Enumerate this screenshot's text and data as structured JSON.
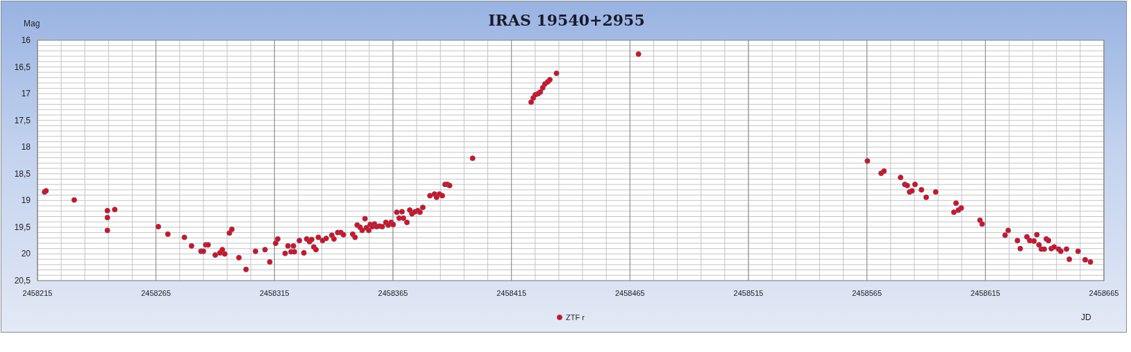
{
  "chart": {
    "chart_data": {
      "type": "scatter",
      "title": "IRAS 19540+2955",
      "xlabel": "JD",
      "ylabel": "Mag",
      "x": [
        2458218,
        2458218.6,
        2458230.5,
        2458244.5,
        2458244.5,
        2458244.5,
        2458247.6,
        2458266,
        2458270,
        2458277,
        2458280,
        2458284,
        2458285,
        2458286,
        2458287,
        2458290,
        2458292,
        2458293,
        2458294,
        2458296,
        2458297,
        2458300,
        2458303,
        2458307,
        2458311,
        2458313,
        2458315.5,
        2458316.4,
        2458319.5,
        2458320.7,
        2458322,
        2458323,
        2458323.4,
        2458325.5,
        2458327.4,
        2458328.6,
        2458329.8,
        2458330.7,
        2458331.6,
        2458332.5,
        2458333.5,
        2458335.3,
        2458336.8,
        2458339.2,
        2458340.1,
        2458341.7,
        2458343,
        2458344.1,
        2458348,
        2458349,
        2458349.9,
        2458351.1,
        2458352,
        2458353.2,
        2458353.8,
        2458354.8,
        2458355.4,
        2458356.3,
        2458357.2,
        2458358.1,
        2458359.3,
        2458360.5,
        2458362,
        2458363,
        2458364.2,
        2458365.1,
        2458366.6,
        2458367.6,
        2458368.8,
        2458369.4,
        2458370.9,
        2458372.1,
        2458373,
        2458374.3,
        2458375.5,
        2458376.4,
        2458377.6,
        2458380.6,
        2458382.5,
        2458383.4,
        2458384.6,
        2458385.8,
        2458387,
        2458388,
        2458388.9,
        2458398.6,
        2458423.3,
        2458424.2,
        2458425.1,
        2458426.3,
        2458427.2,
        2458428.2,
        2458429.1,
        2458430.3,
        2458431.2,
        2458434,
        2458468.6,
        2458565.2,
        2458571,
        2458572.2,
        2458579.2,
        2458581,
        2458582,
        2458583,
        2458584,
        2458585.3,
        2458588,
        2458590,
        2458594,
        2458601.7,
        2458602.6,
        2458603.6,
        2458604.8,
        2458612.7,
        2458613.6,
        2458623.3,
        2458624.6,
        2458628.5,
        2458629.7,
        2458632.5,
        2458633.7,
        2458635.5,
        2458636.7,
        2458637.6,
        2458638.6,
        2458639.8,
        2458640.7,
        2458641.6,
        2458642.8,
        2458644,
        2458645.9,
        2458646.8,
        2458649.2,
        2458650.4,
        2458654.1,
        2458657.1,
        2458659.3
      ],
      "series": [
        {
          "name": "ZTF r",
          "color": "#ff0000",
          "values": [
            18.84,
            18.82,
            18.99,
            19.19,
            19.32,
            19.56,
            19.17,
            19.49,
            19.63,
            19.69,
            19.85,
            19.95,
            19.95,
            19.83,
            19.83,
            20.02,
            19.98,
            19.92,
            20.0,
            19.61,
            19.54,
            20.07,
            20.29,
            19.95,
            19.92,
            20.15,
            19.8,
            19.72,
            19.99,
            19.85,
            19.96,
            19.85,
            19.96,
            19.75,
            19.98,
            19.72,
            19.77,
            19.73,
            19.87,
            19.92,
            19.69,
            19.75,
            19.71,
            19.65,
            19.72,
            19.6,
            19.6,
            19.64,
            19.63,
            19.69,
            19.46,
            19.5,
            19.56,
            19.34,
            19.51,
            19.56,
            19.45,
            19.49,
            19.44,
            19.49,
            19.48,
            19.49,
            19.41,
            19.46,
            19.41,
            19.45,
            19.22,
            19.33,
            19.21,
            19.33,
            19.41,
            19.18,
            19.25,
            19.21,
            19.19,
            19.22,
            19.13,
            18.91,
            18.88,
            18.94,
            18.88,
            18.91,
            18.7,
            18.7,
            18.72,
            18.21,
            17.16,
            17.08,
            17.02,
            17.0,
            16.97,
            16.89,
            16.82,
            16.78,
            16.74,
            16.62,
            16.26,
            18.26,
            18.49,
            18.45,
            18.57,
            18.7,
            18.72,
            18.84,
            18.82,
            18.7,
            18.8,
            18.94,
            18.84,
            19.22,
            19.05,
            19.18,
            19.14,
            19.37,
            19.44,
            19.65,
            19.56,
            19.75,
            19.9,
            19.68,
            19.75,
            19.76,
            19.64,
            19.83,
            19.91,
            19.91,
            19.72,
            19.75,
            19.9,
            19.87,
            19.91,
            19.95,
            19.91,
            20.1,
            19.95,
            20.11,
            20.15
          ]
        }
      ],
      "grid": true,
      "xlim": [
        2458215,
        2458665
      ],
      "ylim": [
        20.5,
        16
      ],
      "xticks": [
        2458215,
        2458265,
        2458315,
        2458365,
        2458415,
        2458465,
        2458515,
        2458565,
        2458615,
        2458665
      ],
      "yticks": [
        {
          "value": 16,
          "label": "16"
        },
        {
          "value": 16.5,
          "label": "16,5"
        },
        {
          "value": 17,
          "label": "17"
        },
        {
          "value": 17.5,
          "label": "17,5"
        },
        {
          "value": 18,
          "label": "18"
        },
        {
          "value": 18.5,
          "label": "18,5"
        },
        {
          "value": 19,
          "label": "19"
        },
        {
          "value": 19.5,
          "label": "19,5"
        },
        {
          "value": 20,
          "label": "20"
        },
        {
          "value": 20.5,
          "label": "20,5"
        }
      ]
    }
  }
}
